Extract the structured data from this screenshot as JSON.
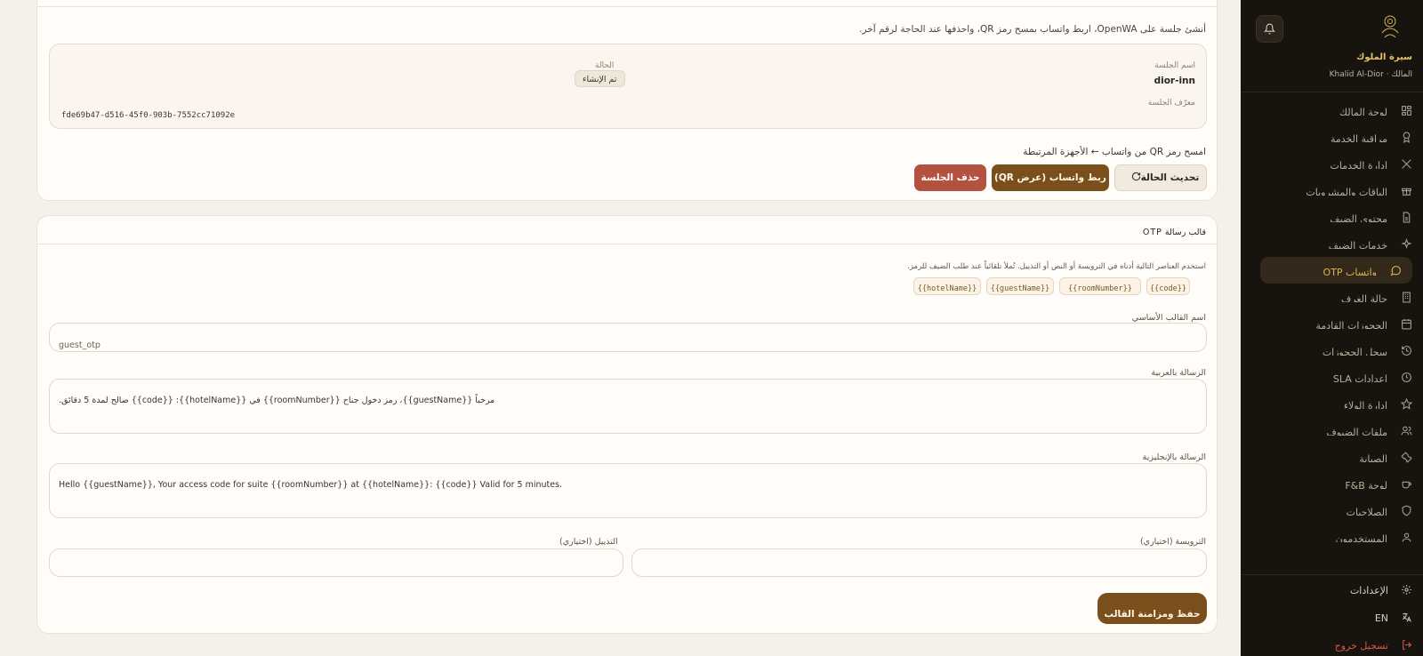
{
  "sidebar": {
    "brand": "سيرة الملوك",
    "owner_line": "المالك · Khalid Al-Dior",
    "items": [
      {
        "label": "لوحة المالك",
        "icon": "dashboard-icon"
      },
      {
        "label": "مراقبة الخدمة",
        "icon": "award-icon"
      },
      {
        "label": "إدارة الخدمات",
        "icon": "utensils-icon"
      },
      {
        "label": "الباقات والمشروبات",
        "icon": "gift-icon"
      },
      {
        "label": "محتوى الضيف",
        "icon": "document-icon"
      },
      {
        "label": "خدمات الضيف",
        "icon": "sparkles-icon"
      },
      {
        "label": "واتساب OTP",
        "icon": "chat-icon",
        "active": true
      },
      {
        "label": "حالة الغرف",
        "icon": "building-icon"
      },
      {
        "label": "الحجوزات القادمة",
        "icon": "calendar-icon"
      },
      {
        "label": "سجل الحجوزات",
        "icon": "history-icon"
      },
      {
        "label": "إعدادات SLA",
        "icon": "clock-icon"
      },
      {
        "label": "إدارة الولاء",
        "icon": "star-icon"
      },
      {
        "label": "ملفات الضيوف",
        "icon": "users-icon"
      },
      {
        "label": "الصيانة",
        "icon": "wrench-icon"
      },
      {
        "label": "لوحة F&B",
        "icon": "coffee-icon"
      },
      {
        "label": "الصلاحيات",
        "icon": "shield-icon"
      },
      {
        "label": "المستخدمون",
        "icon": "user-icon"
      }
    ],
    "settings_label": "الإعدادات",
    "lang_label": "EN",
    "logout_label": "تسجيل خروج"
  },
  "session": {
    "intro": "أنشئ جلسة على OpenWA، اربط واتساب بمسح رمز QR، واحذفها عند الحاجة لرقم آخر.",
    "name_label": "اسم الجلسة",
    "name_value": "dior-inn",
    "state_label": "الحالة",
    "state_value": "تم الإنشاء",
    "id_label": "معرّف الجلسة",
    "id_value": "fde69b47-d516-45f0-903b-7552cc71092e",
    "scan_hint": "امسح رمز QR من واتساب ← الأجهزة المرتبطة",
    "refresh_label": "تحديث الحالة",
    "link_label": "ربط واتساب (عرض QR)",
    "delete_label": "حذف الجلسة"
  },
  "template": {
    "title": "قالب رسالة OTP",
    "hint": "استخدم العناصر التالية أدناه في الترويسة أو النص أو التذييل. تُملأ تلقائياً عند طلب الضيف للرمز.",
    "placeholders": [
      "{{code}}",
      "{{roomNumber}}",
      "{{guestName}}",
      "{{hotelName}}"
    ],
    "base_name_label": "اسم القالب الأساسي",
    "base_name_value": "guest_otp",
    "arabic_label": "الرسالة بالعربية",
    "arabic_value": "مرحباً {{guestName}}، رمز دخول جناح {{roomNumber}} في {{hotelName}}: {{code}} صالح لمدة 5 دقائق.",
    "english_label": "الرسالة بالإنجليزية",
    "english_value": "Hello {{guestName}}, Your access code for suite {{roomNumber}} at {{hotelName}}: {{code}} Valid for 5 minutes.",
    "header_label": "الترويسة (اختياري)",
    "header_value": "",
    "footer_label": "التذييل (اختياري)",
    "footer_value": "",
    "save_label": "حفظ ومزامنة القالب"
  },
  "colors": {
    "sidebar_bg": "#17130f",
    "accent_gold": "#e2b44f",
    "primary_brown": "#7a4f1c",
    "danger": "#b4513f",
    "page_bg": "#f4f0ea"
  }
}
